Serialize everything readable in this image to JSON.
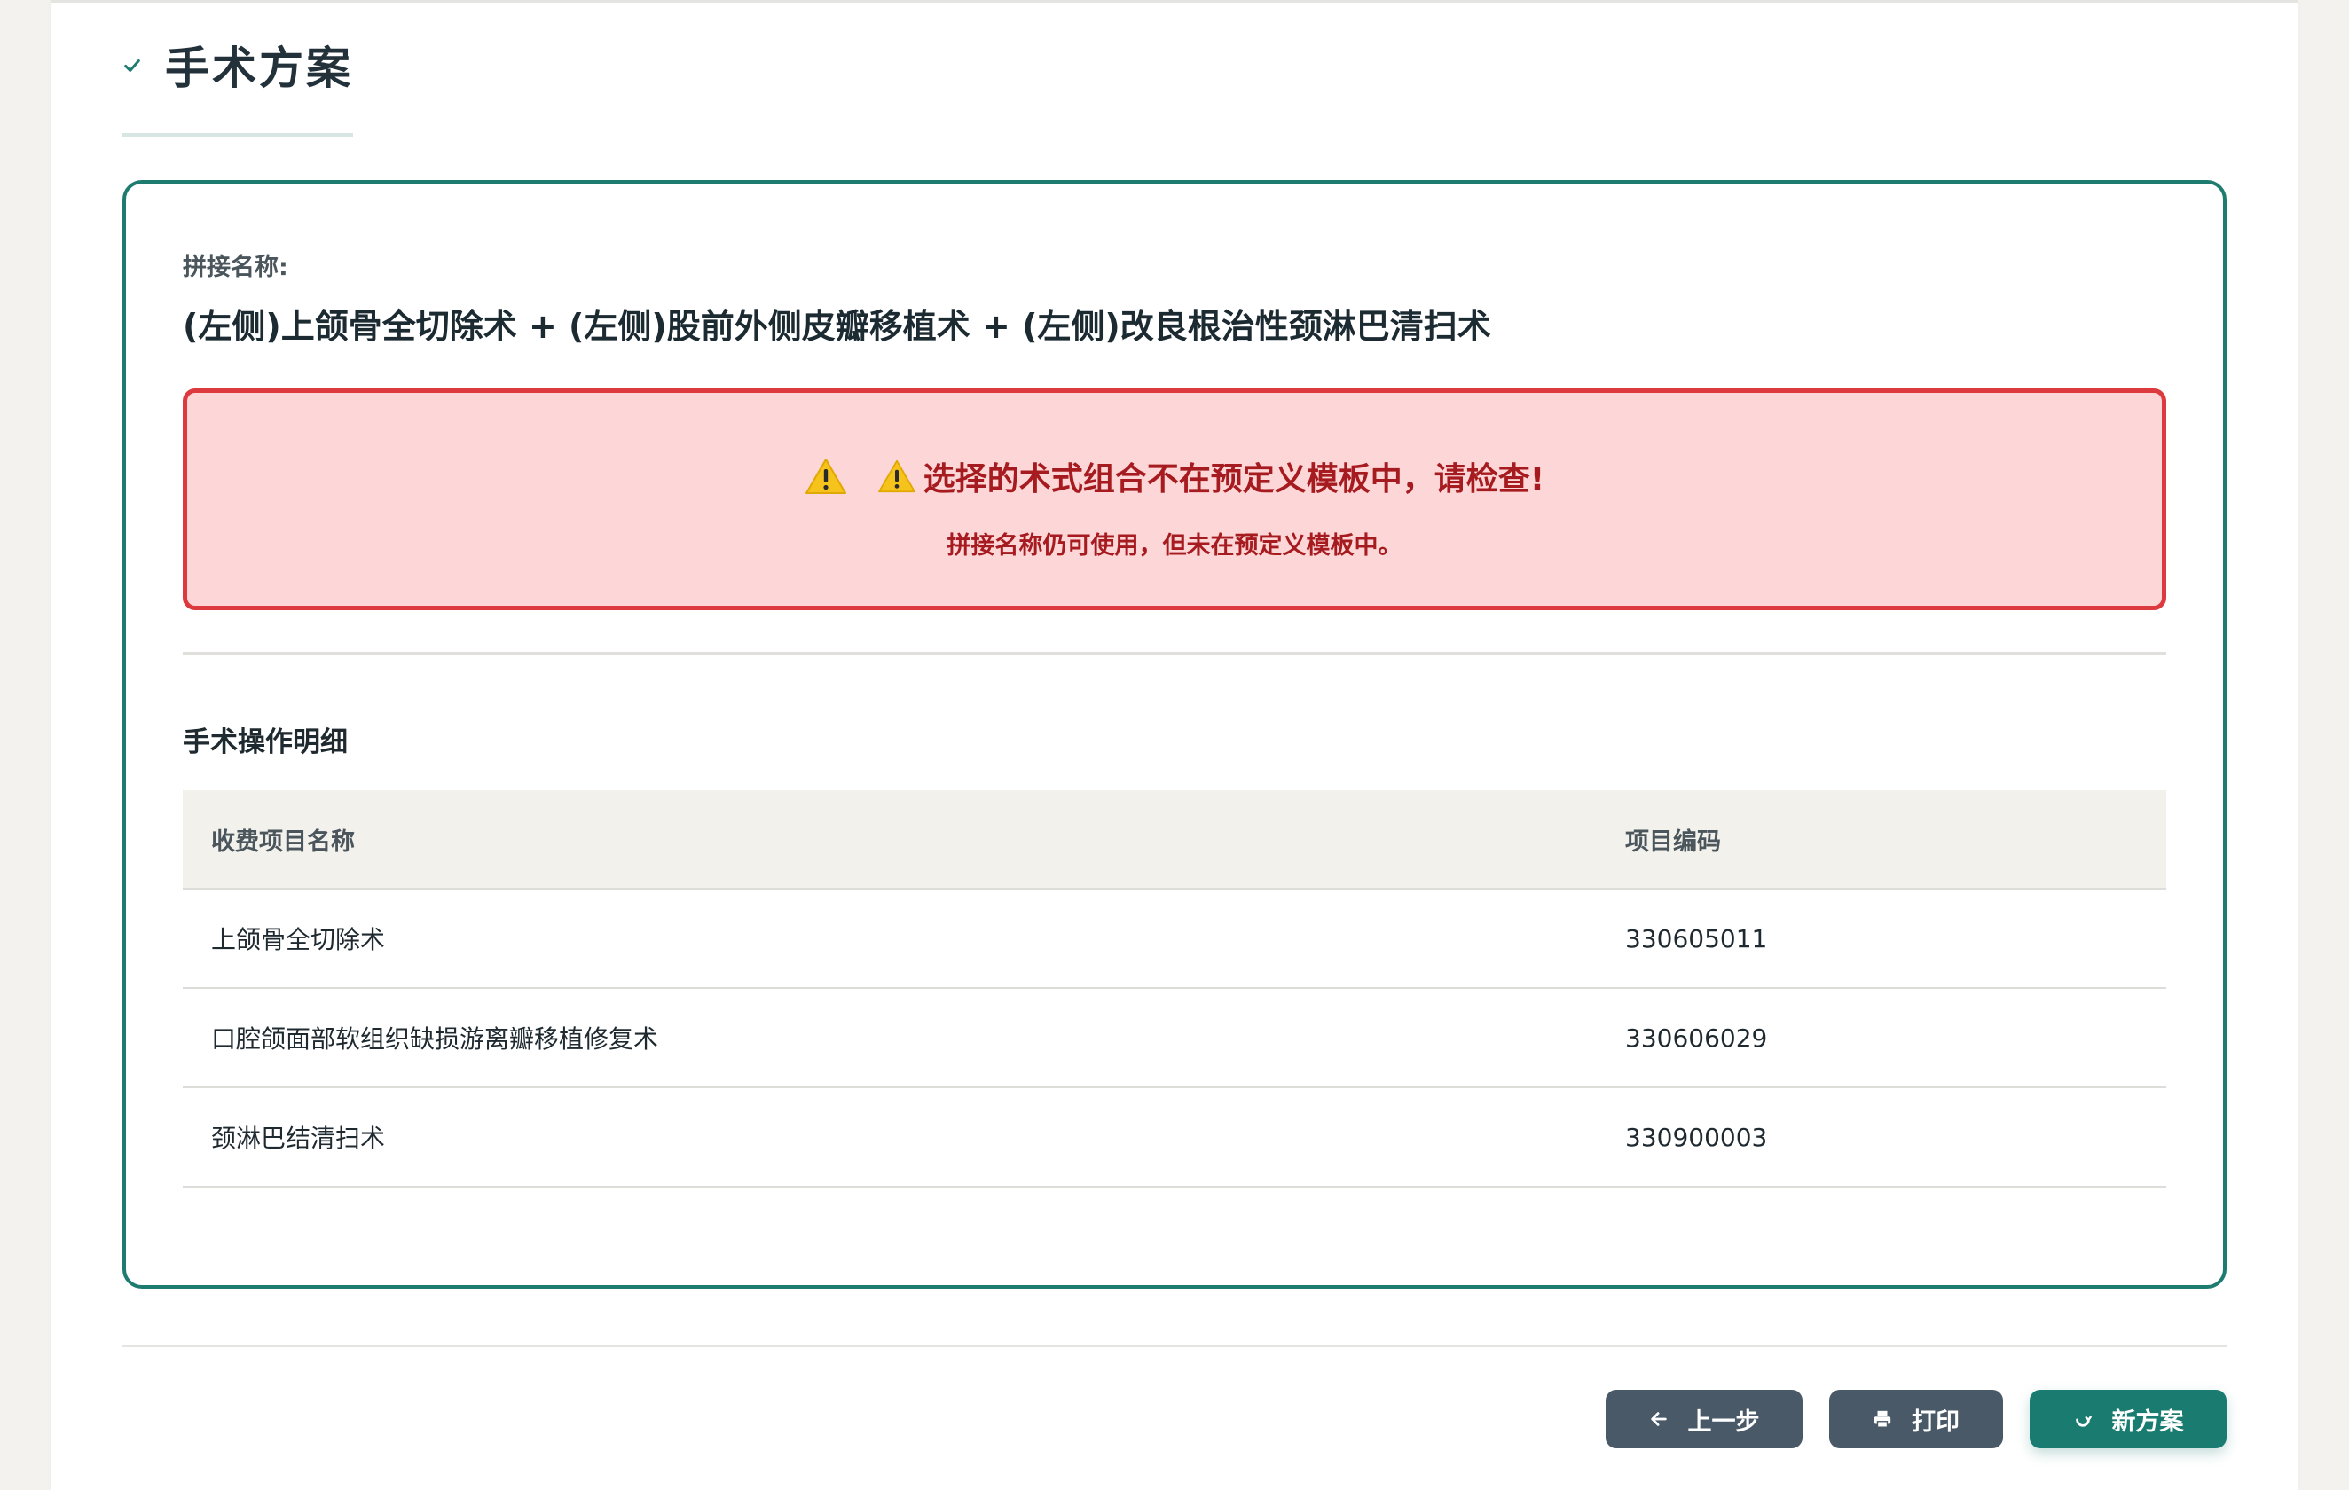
{
  "header": {
    "title": "手术方案",
    "check_icon": "check-icon"
  },
  "combined": {
    "label": "拼接名称:",
    "name": "(左侧)上颌骨全切除术 + (左侧)股前外侧皮瓣移植术 + (左侧)改良根治性颈淋巴清扫术"
  },
  "alert": {
    "icon": "warning-icon",
    "title": "选择的术式组合不在预定义模板中，请检查!",
    "subtitle": "拼接名称仍可使用，但未在预定义模板中。",
    "bg_color": "#fdd6d7",
    "border_color": "#dc3a3f",
    "text_color": "#a61b1f"
  },
  "details": {
    "title": "手术操作明细",
    "columns": [
      "收费项目名称",
      "项目编码"
    ],
    "rows": [
      {
        "name": "上颌骨全切除术",
        "code": "330605011"
      },
      {
        "name": "口腔颌面部软组织缺损游离瓣移植修复术",
        "code": "330606029"
      },
      {
        "name": "颈淋巴结清扫术",
        "code": "330900003"
      }
    ]
  },
  "buttons": {
    "prev": {
      "label": "上一步",
      "icon": "arrow-left-icon"
    },
    "print": {
      "label": "打印",
      "icon": "printer-icon"
    },
    "new": {
      "label": "新方案",
      "icon": "refresh-icon"
    }
  },
  "colors": {
    "accent": "#1e7b70",
    "secondary_button": "#4a5967"
  }
}
